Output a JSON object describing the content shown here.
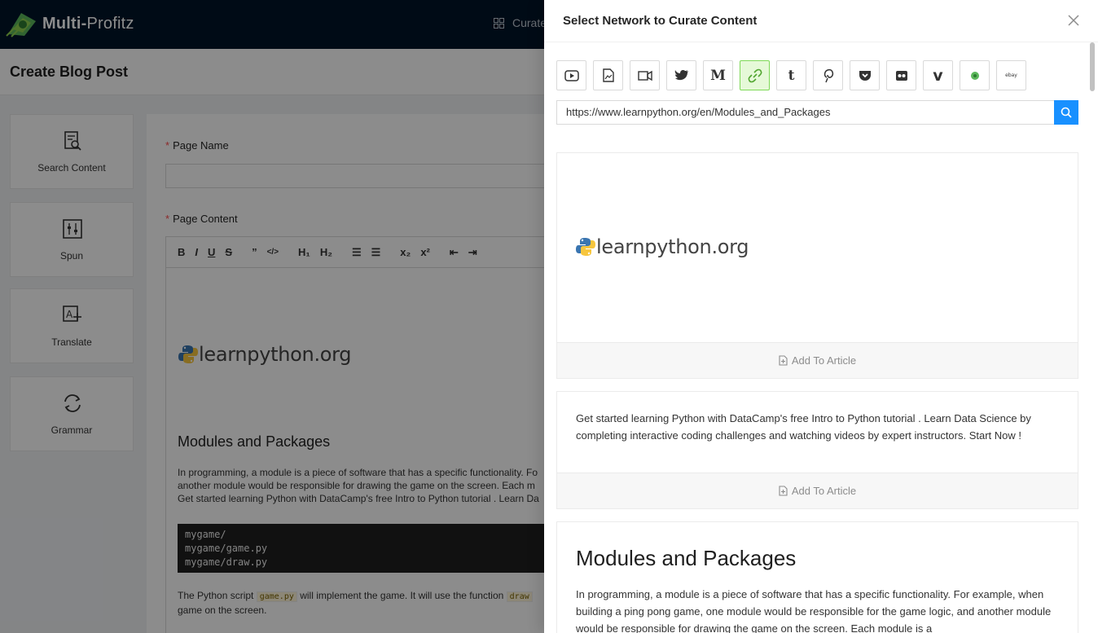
{
  "app": {
    "brand_bold": "Multi-",
    "brand_rest": "Profitz",
    "top_nav_label": "Curate"
  },
  "page": {
    "title": "Create Blog Post"
  },
  "tools": [
    {
      "label": "Search Content",
      "icon": "search-content-icon"
    },
    {
      "label": "Spun",
      "icon": "sliders-icon"
    },
    {
      "label": "Translate",
      "icon": "translate-icon"
    },
    {
      "label": "Grammar",
      "icon": "sync-icon"
    }
  ],
  "form": {
    "page_name_label": "Page Name",
    "page_content_label": "Page Content",
    "toolbar": [
      "B",
      "I",
      "U",
      "S",
      "”",
      "</>",
      "H1",
      "H2",
      "OL",
      "UL",
      "x2",
      "x2",
      "outdent",
      "indent"
    ]
  },
  "editor": {
    "logo_text": "learnpython.org",
    "heading": "Modules and Packages",
    "paragraph_lines": [
      "In programming, a module is a piece of software that has a specific functionality. Fo",
      " another module would be responsible for drawing the game on the screen. Each m",
      "Get started learning Python with DataCamp's free Intro to Python tutorial . Learn Da"
    ],
    "code_lines": [
      "mygame/",
      "mygame/game.py",
      "mygame/draw.py"
    ],
    "p2_before": "The Python script ",
    "p2_code": "game.py",
    "p2_after": " will implement the game. It will use the function ",
    "p2_code2": "draw",
    "p2_line2": "game on the screen."
  },
  "drawer": {
    "title": "Select Network to Curate Content",
    "networks": [
      {
        "name": "youtube",
        "icon": "youtube-icon",
        "active": false
      },
      {
        "name": "document",
        "icon": "file-image-icon",
        "active": false
      },
      {
        "name": "video",
        "icon": "video-camera-icon",
        "active": false
      },
      {
        "name": "twitter",
        "icon": "twitter-icon",
        "active": false
      },
      {
        "name": "medium",
        "icon": "medium-icon",
        "active": false,
        "glyph": "M"
      },
      {
        "name": "link",
        "icon": "link-icon",
        "active": true
      },
      {
        "name": "tumblr",
        "icon": "tumblr-icon",
        "active": false,
        "glyph": "t"
      },
      {
        "name": "pinterest",
        "icon": "pinterest-icon",
        "active": false
      },
      {
        "name": "pocket",
        "icon": "pocket-icon",
        "active": false
      },
      {
        "name": "flickr",
        "icon": "flickr-icon",
        "active": false
      },
      {
        "name": "vimeo",
        "icon": "vimeo-icon",
        "active": false,
        "glyph": "v"
      },
      {
        "name": "green-network",
        "icon": "green-circle-icon",
        "active": false
      },
      {
        "name": "ebay",
        "icon": "ebay-icon",
        "active": false,
        "glyph": "ebay"
      }
    ],
    "url_value": "https://www.learnpython.org/en/Modules_and_Packages",
    "add_label": "Add To Article",
    "card1_logo": "learnpython.org",
    "card2_text": "Get started learning Python with DataCamp's free Intro to Python tutorial . Learn Data Science by completing interactive coding challenges and watching videos by expert instructors. Start Now !",
    "card3_heading": "Modules and Packages",
    "card3_text": "In programming, a module is a piece of software that has a specific functionality. For example, when building a ping pong game, one module would be responsible for the game logic, and another module would be responsible for drawing the game on the screen. Each module is a"
  },
  "colors": {
    "topbar": "#001529",
    "primary": "#1890ff",
    "active_net_bg": "#e6f9d8",
    "active_net_border": "#7ed957"
  }
}
